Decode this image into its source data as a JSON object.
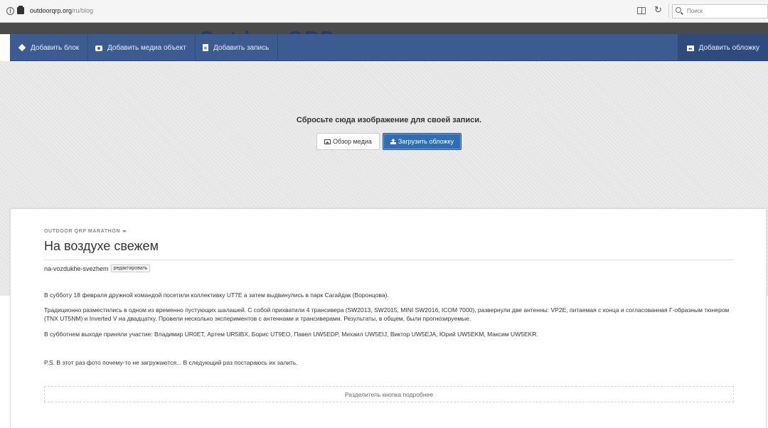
{
  "browser": {
    "info_glyph": "i",
    "url_host": "outdoorqrp.org",
    "url_path": "/ru/blog",
    "reload_glyph": "↻",
    "search_placeholder": "Поиск"
  },
  "site": {
    "logo_text": "OutdoorQRP"
  },
  "toolbar": {
    "add_block": "Добавить блок",
    "add_media": "Добавить медиа объект",
    "add_post": "Добавить запись",
    "add_cover": "Добавить обложку"
  },
  "cover": {
    "drop_text": "Сбросьте сюда изображение для своей записи.",
    "browse_media": "Обзор медиа",
    "upload_cover": "Загрузить обложку"
  },
  "post": {
    "category": "OUTDOOR QRP MARATHON",
    "title": "На воздухе свежем",
    "slug": "na-vozdukhe-svezhem",
    "edit_label": "редактировать",
    "paragraphs": [
      "В субботу 18 февраля дружной командой посетили коллективку UT7E а затем выдвинулись в парк Сагайдак (Воронцова).",
      "Традиционно разместились в одном из временно пустующих шалашей. С собой прихватили 4 трансивера (SW2013, SW2015, MINI SW2016, ICOM 7000), развернули две антенны: VP2E, питаемая с конца и согласованная Г-образным тюнером (TNX UT5NM) и Inverted V на двадцатку. Провели несколько экспериментов с антеннами и трансиверами. Результаты, в общем, были прогнозируемые.",
      "В субботнем выходе приняли участие: Владимир UR0ET, Артем UR5IBX, Борис UT9EO, Павел UW5EDP, Михаил UW5EIJ, Виктор UW5EJA, Юрий UW5EKM, Максим UW5EKR.",
      "P.S. В этот раз фото почему-то не загружаются... В следующий раз постараюсь их залить."
    ],
    "more_divider": "Разделитель кнопка подробнее"
  }
}
